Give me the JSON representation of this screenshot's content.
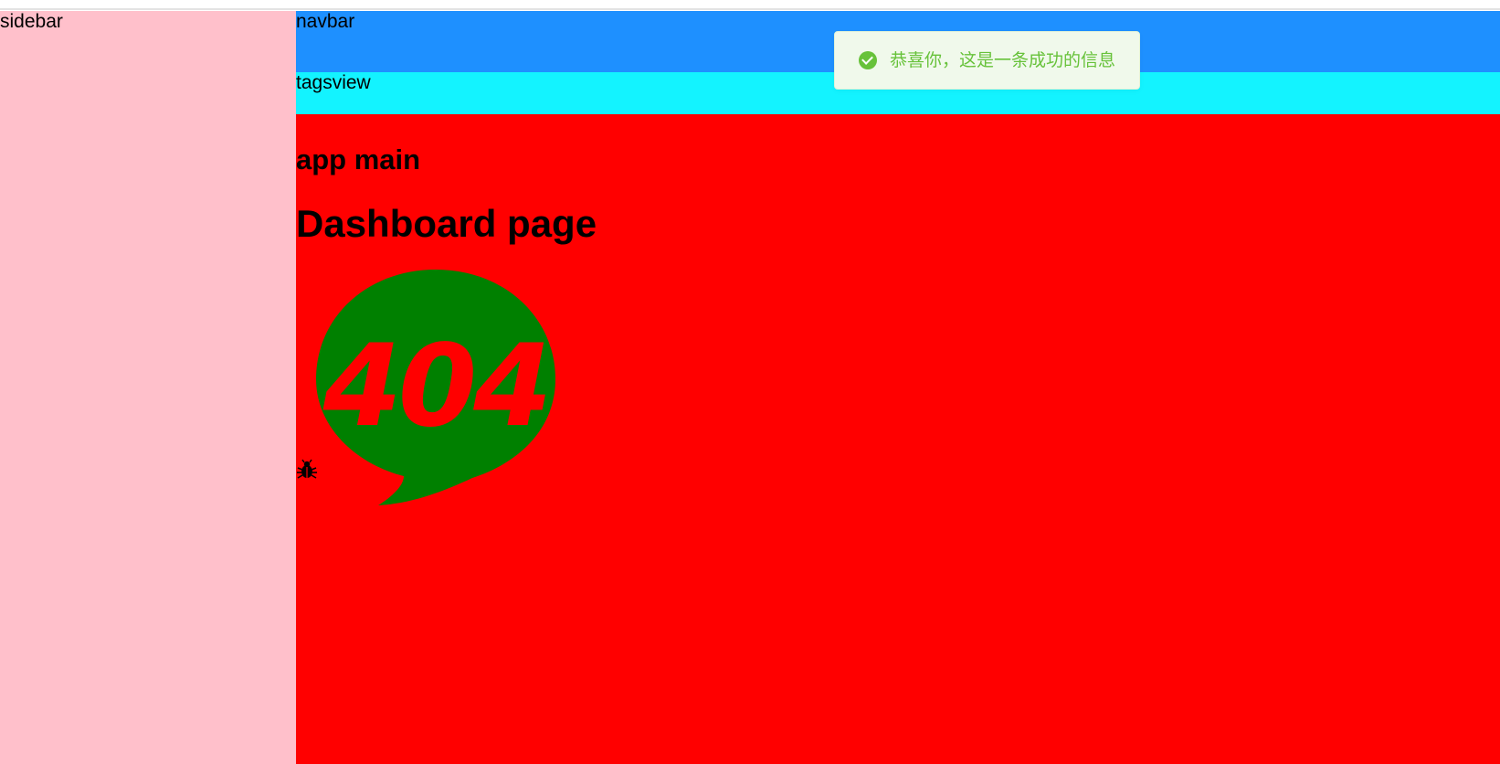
{
  "sidebar": {
    "label": "sidebar"
  },
  "navbar": {
    "label": "navbar"
  },
  "tagsview": {
    "label": "tagsview"
  },
  "app_main": {
    "label": "app main",
    "page_title": "Dashboard page",
    "illustration_text": "404",
    "illustration_icon": "speech-bubble-404-icon",
    "bug_icon": "bug-icon"
  },
  "message": {
    "type": "success",
    "icon": "check-circle-icon",
    "text": "恭喜你，这是一条成功的信息"
  },
  "colors": {
    "sidebar": "#ffc0cb",
    "navbar": "#1e90ff",
    "tagsview": "#13f3ff",
    "app_main": "#ff0000",
    "illustration": "#008000",
    "message_bg": "#f0f9eb",
    "message_text": "#67c23a"
  }
}
